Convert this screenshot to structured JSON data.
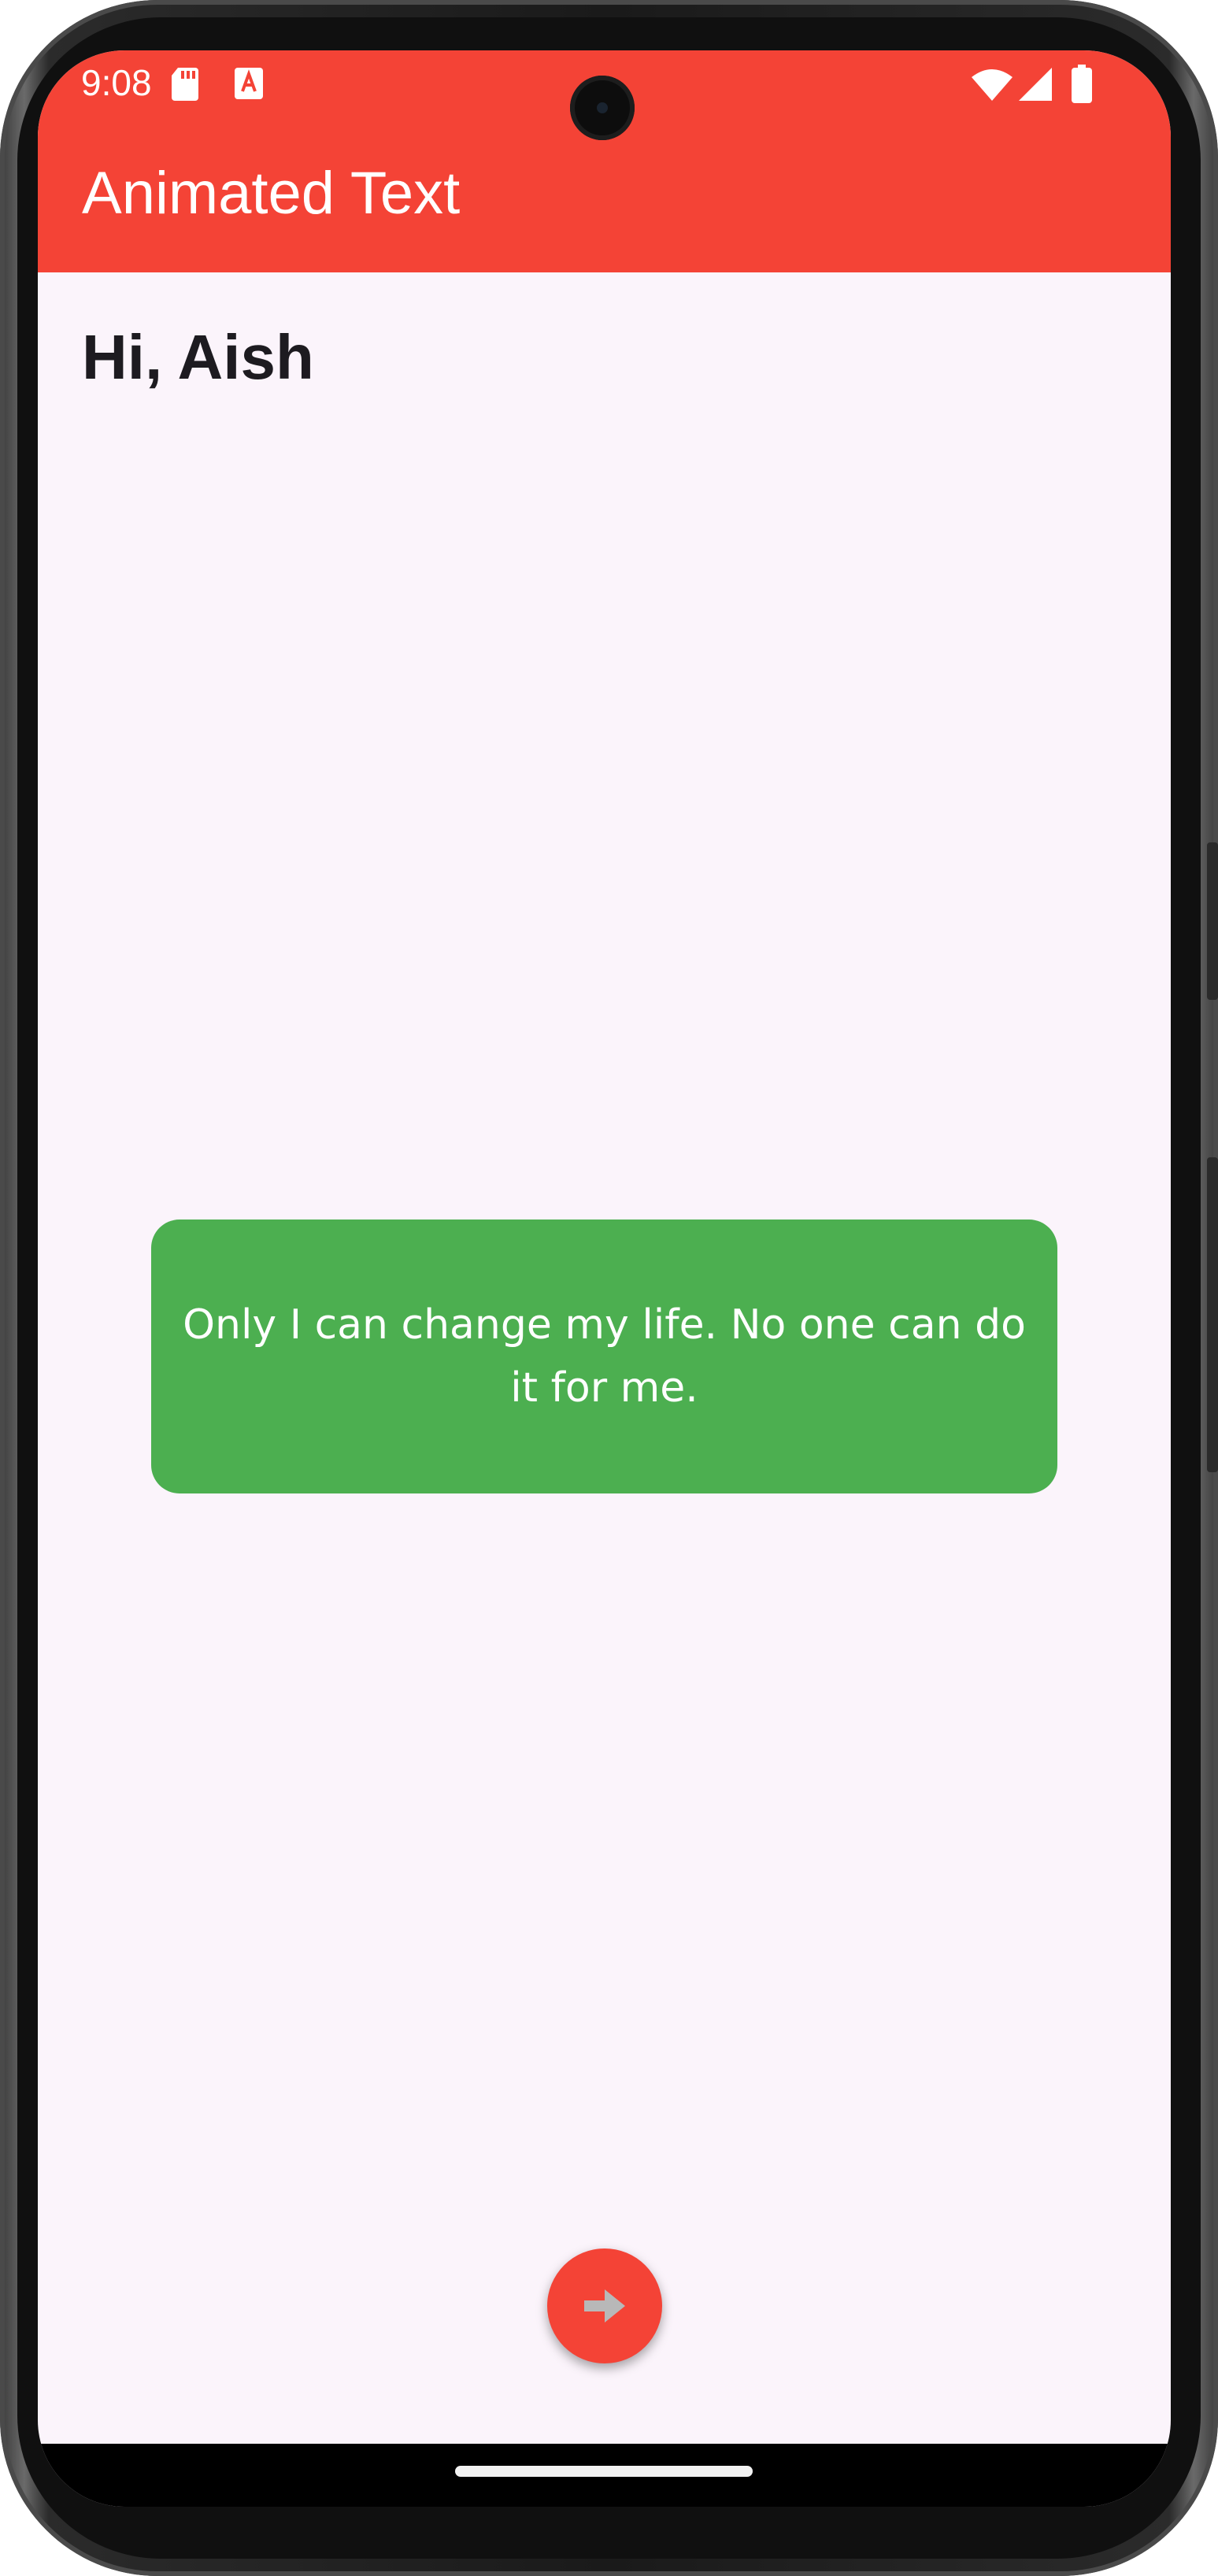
{
  "status_bar": {
    "time": "9:08",
    "left_icons": [
      "sd-card-icon",
      "text-a-icon"
    ],
    "right_icons": [
      "wifi-icon",
      "signal-icon",
      "battery-icon"
    ]
  },
  "app_bar": {
    "title": "Animated Text",
    "color": "#F44336"
  },
  "content": {
    "greeting": "Hi, Aish",
    "quote": "Only I can change my life. No one can do it for me.",
    "quote_card_color": "#4CAF50",
    "background_color": "#FBF4FB"
  },
  "fab": {
    "icon": "arrow-forward-icon",
    "color": "#F44336"
  }
}
